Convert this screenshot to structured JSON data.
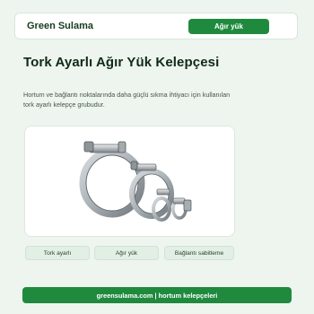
{
  "header": {
    "brand": "Green Sulama",
    "cta_label": "Ağır yük"
  },
  "main": {
    "title": "Tork Ayarlı Ağır Yük Kelepçesi",
    "description": "Hortum ve bağlantı noktalarında daha güçlü sıkma ihtiyacı için kullanılan tork ayarlı kelepçe grubudur.",
    "product_image": "heavy-duty torque clamp set"
  },
  "tags": [
    "Tork ayarlı",
    "Ağır yük",
    "Bağlantı sabitleme"
  ],
  "footer": {
    "text": "greensulama.com | hortum kelepçeleri"
  },
  "colors": {
    "accent": "#1f8a3e",
    "background": "#eef5ef",
    "text_dark": "#102a16"
  }
}
